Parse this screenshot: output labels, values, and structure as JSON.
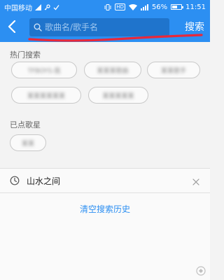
{
  "status_bar": {
    "carrier": "中国移动",
    "battery": "56%",
    "time": "11:51"
  },
  "header": {
    "search_placeholder": "歌曲名/歌手名",
    "search_label": "搜索"
  },
  "hot_search": {
    "title": "热门搜索",
    "chips": [
      "TFBOYS-我",
      "某某某歌曲",
      "某某歌手",
      "某某某某某某",
      "某某某某某"
    ]
  },
  "clicked_singers": {
    "title": "已点歌星",
    "chips": [
      "某某"
    ]
  },
  "history": {
    "items": [
      {
        "label": "山水之间"
      }
    ],
    "clear_label": "清空搜索历史"
  },
  "colors": {
    "primary": "#2c8ff2",
    "search_bg": "#1f74cc",
    "annotation": "#e8283a"
  }
}
